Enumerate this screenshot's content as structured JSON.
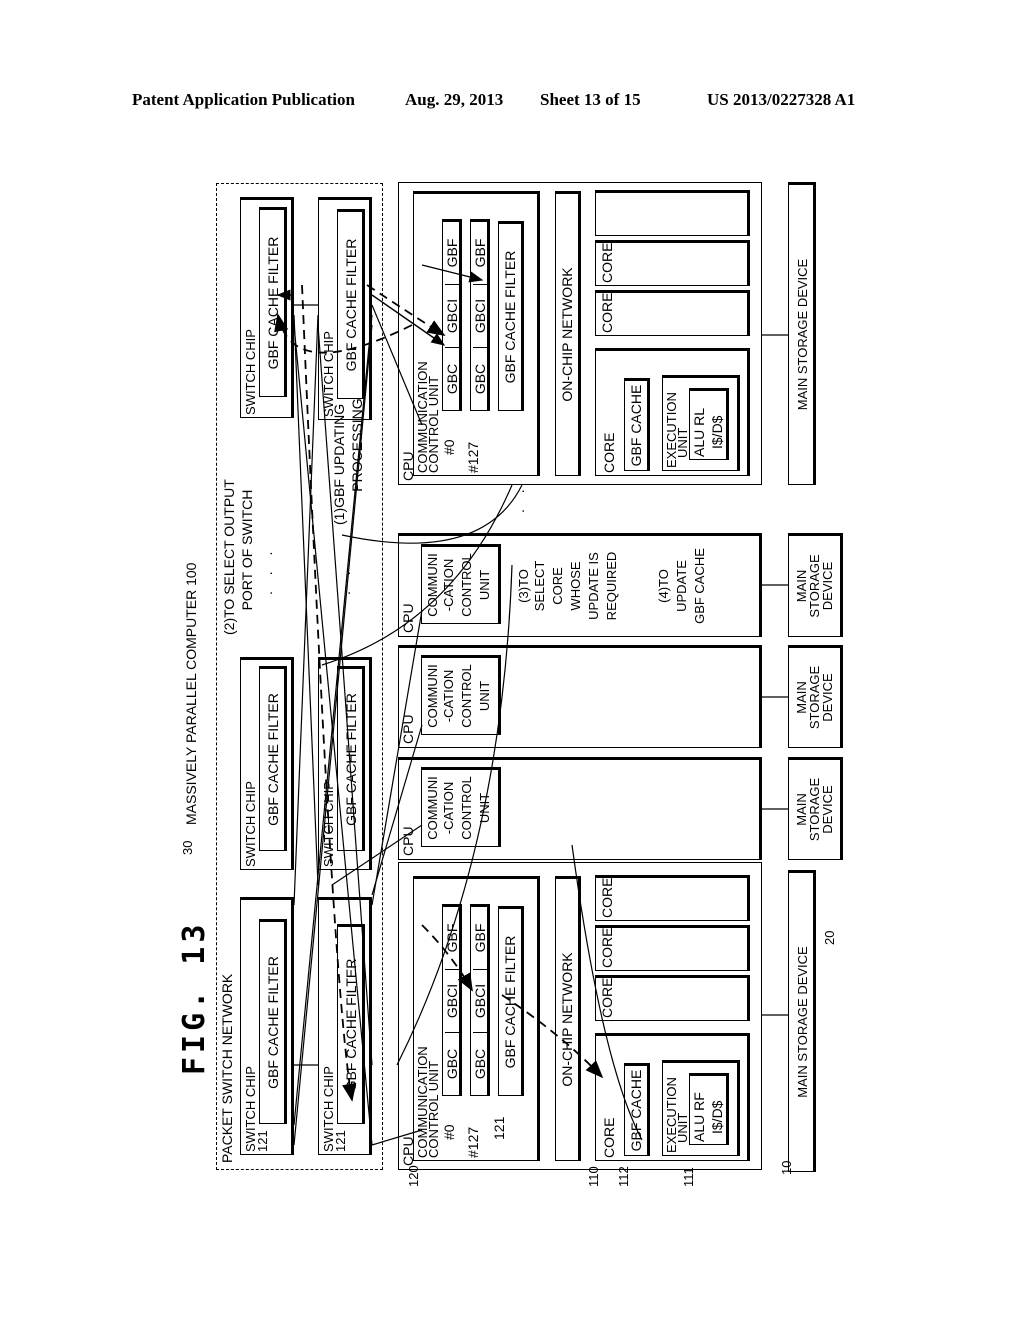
{
  "header": {
    "publication": "Patent Application Publication",
    "date": "Aug. 29, 2013",
    "sheet": "Sheet 13 of 15",
    "number": "US 2013/0227328 A1"
  },
  "figure": {
    "title": "FIG. 13",
    "system_ref": "30",
    "system_label": "MASSIVELY PARALLEL COMPUTER 100",
    "network_label": "PACKET SWITCH NETWORK",
    "switch_chip_label": "SWITCH CHIP",
    "filter_label": "GBF CACHE FILTER",
    "switch_ref": "121",
    "cpu_label": "CPU",
    "ccu_label_full": "COMMUNICATION CONTROL UNIT",
    "ccu_line1": "COMMUNICATION",
    "ccu_line2": "CONTROL UNIT",
    "ccu_short": [
      "COMMUNI",
      "-CATION",
      "CONTROL",
      "UNIT"
    ],
    "entry0": "#0",
    "entry127": "#127",
    "gbc": "GBC",
    "gbci": "GBCI",
    "gbf": "GBF",
    "on_chip_network": "ON-CHIP NETWORK",
    "core": "CORE",
    "gbf_cache": "GBF CACHE",
    "execution_unit_1": "EXECUTION",
    "execution_unit_2": "UNIT",
    "alu_rf": "ALU RF",
    "alu_rl": "ALU RL",
    "i_d_cache": "I$/D$",
    "main_storage": "MAIN STORAGE DEVICE",
    "main_storage_short": [
      "MAIN",
      "STORAGE",
      "DEVICE"
    ],
    "ellipsis": ". . .",
    "steps": {
      "s1": [
        "(1)GBF UPDATING",
        "PROCESSING"
      ],
      "s2": [
        "(2)TO SELECT OUTPUT",
        "PORT OF SWITCH"
      ],
      "s3": [
        "(3)TO",
        "SELECT",
        "CORE",
        "WHOSE",
        "UPDATE IS",
        "REQUIRED"
      ],
      "s4": [
        "(4)TO",
        "UPDATE",
        "GBF CACHE"
      ]
    },
    "refs": {
      "r10": "10",
      "r120": "120",
      "r121": "121",
      "r110": "110",
      "r112": "112",
      "r111": "111",
      "r20": "20"
    }
  }
}
